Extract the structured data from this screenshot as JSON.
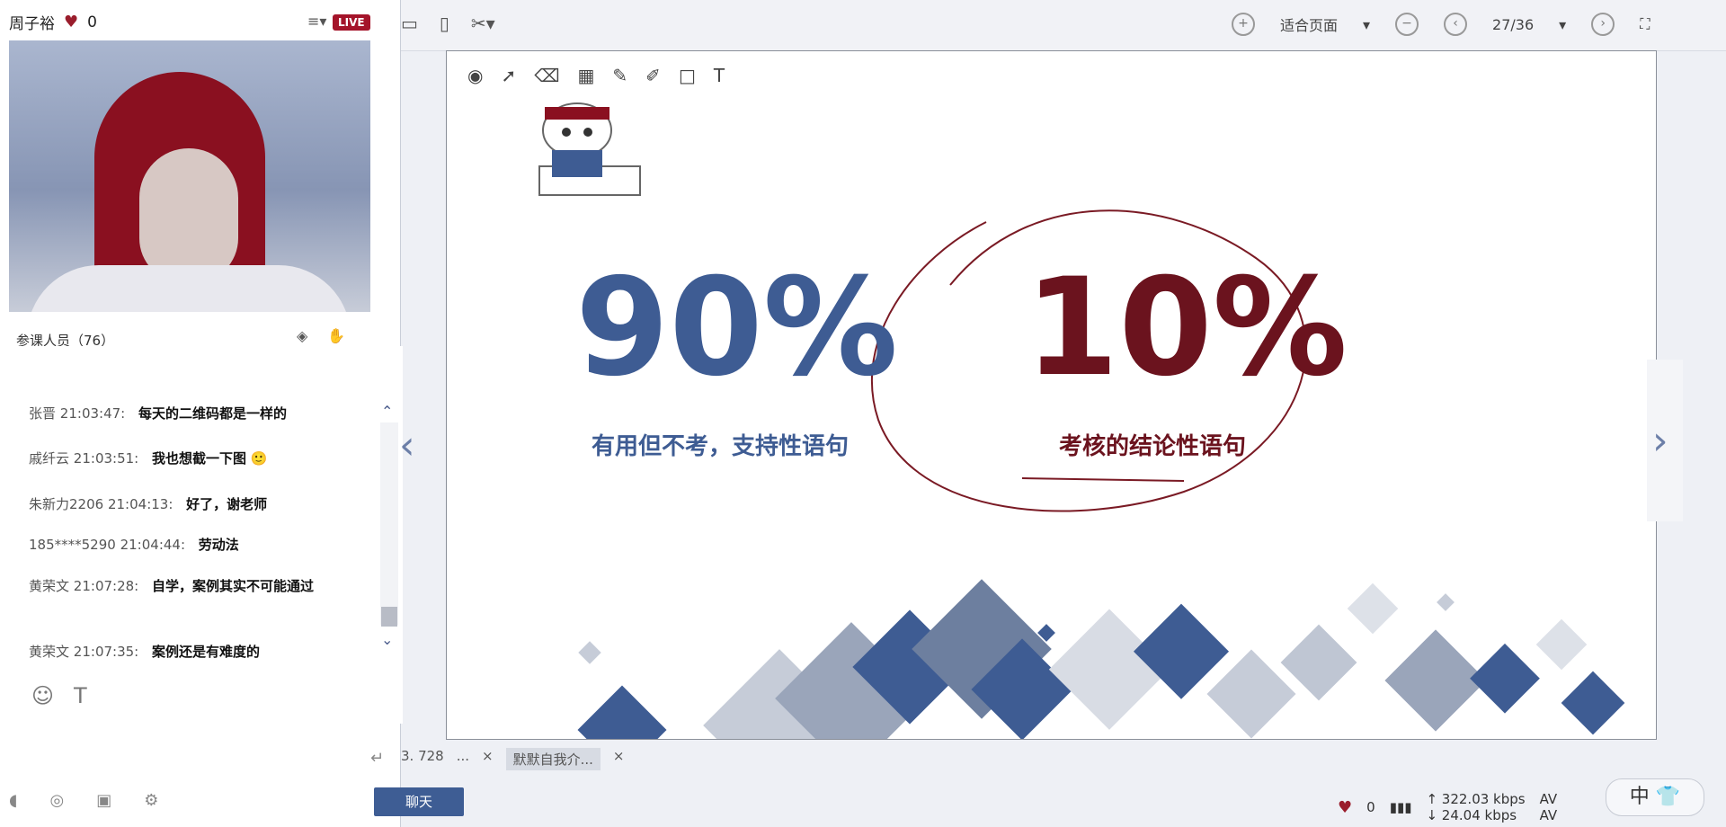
{
  "host": {
    "name": "周子裕",
    "likes": "0",
    "live_badge": "LIVE"
  },
  "class_count": "参课人员（76）",
  "chat": {
    "messages": [
      {
        "who": "张晋",
        "time": "21:03:47:",
        "text": "每天的二维码都是一样的"
      },
      {
        "who": "戚纤云",
        "time": "21:03:51:",
        "text": "我也想截一下图"
      },
      {
        "who": "朱新力2206",
        "time": "21:04:13:",
        "text": "好了，谢老师"
      },
      {
        "who": "185****5290",
        "time": "21:04:44:",
        "text": "劳动法"
      },
      {
        "who": "黄荣文",
        "time": "21:07:28:",
        "text": "自学，案例其实不可能通过"
      },
      {
        "who": "黄荣文",
        "time": "21:07:35:",
        "text": "案例还是有难度的"
      }
    ],
    "chat_tab_label": "聊天"
  },
  "viewer": {
    "fit_label": "适合页面",
    "page_indicator": "27/36",
    "slide": {
      "left_percent": "90%",
      "left_caption": "有用但不考，支持性语句",
      "right_percent": "10%",
      "right_caption": "考核的结论性语句"
    }
  },
  "tabs": {
    "tab1": "3. 728",
    "tab2": "...",
    "tab3": "默默自我介..."
  },
  "status": {
    "likes": "0",
    "upload": "322.03 kbps",
    "download": "24.04 kbps",
    "av1": "AV",
    "av2": "AV",
    "ime": "中"
  }
}
